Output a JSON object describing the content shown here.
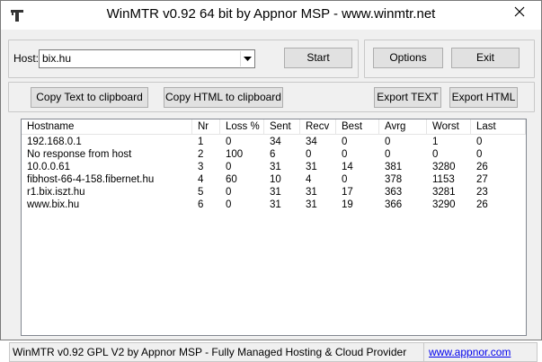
{
  "window": {
    "title": "WinMTR v0.92 64 bit by Appnor MSP - www.winmtr.net",
    "icon": "winmtr-app-icon",
    "close_icon": "close-icon"
  },
  "host": {
    "label": "Host:",
    "value": "bix.hu",
    "dropdown_icon": "chevron-down-icon"
  },
  "buttons": {
    "start": "Start",
    "options": "Options",
    "exit": "Exit",
    "copy_text": "Copy Text to clipboard",
    "copy_html": "Copy HTML to clipboard",
    "export_text": "Export TEXT",
    "export_html": "Export HTML"
  },
  "table": {
    "columns": [
      "Hostname",
      "Nr",
      "Loss %",
      "Sent",
      "Recv",
      "Best",
      "Avrg",
      "Worst",
      "Last"
    ],
    "rows": [
      [
        "192.168.0.1",
        "1",
        "0",
        "34",
        "34",
        "0",
        "0",
        "1",
        "0"
      ],
      [
        "No response from host",
        "2",
        "100",
        "6",
        "0",
        "0",
        "0",
        "0",
        "0"
      ],
      [
        "10.0.0.61",
        "3",
        "0",
        "31",
        "31",
        "14",
        "381",
        "3280",
        "26"
      ],
      [
        "fibhost-66-4-158.fibernet.hu",
        "4",
        "60",
        "10",
        "4",
        "0",
        "378",
        "1153",
        "27"
      ],
      [
        "r1.bix.iszt.hu",
        "5",
        "0",
        "31",
        "31",
        "17",
        "363",
        "3281",
        "23"
      ],
      [
        "www.bix.hu",
        "6",
        "0",
        "31",
        "31",
        "19",
        "366",
        "3290",
        "26"
      ]
    ]
  },
  "status": {
    "text": "WinMTR v0.92 GPL V2 by Appnor MSP - Fully Managed Hosting & Cloud Provider",
    "link": "www.appnor.com"
  }
}
